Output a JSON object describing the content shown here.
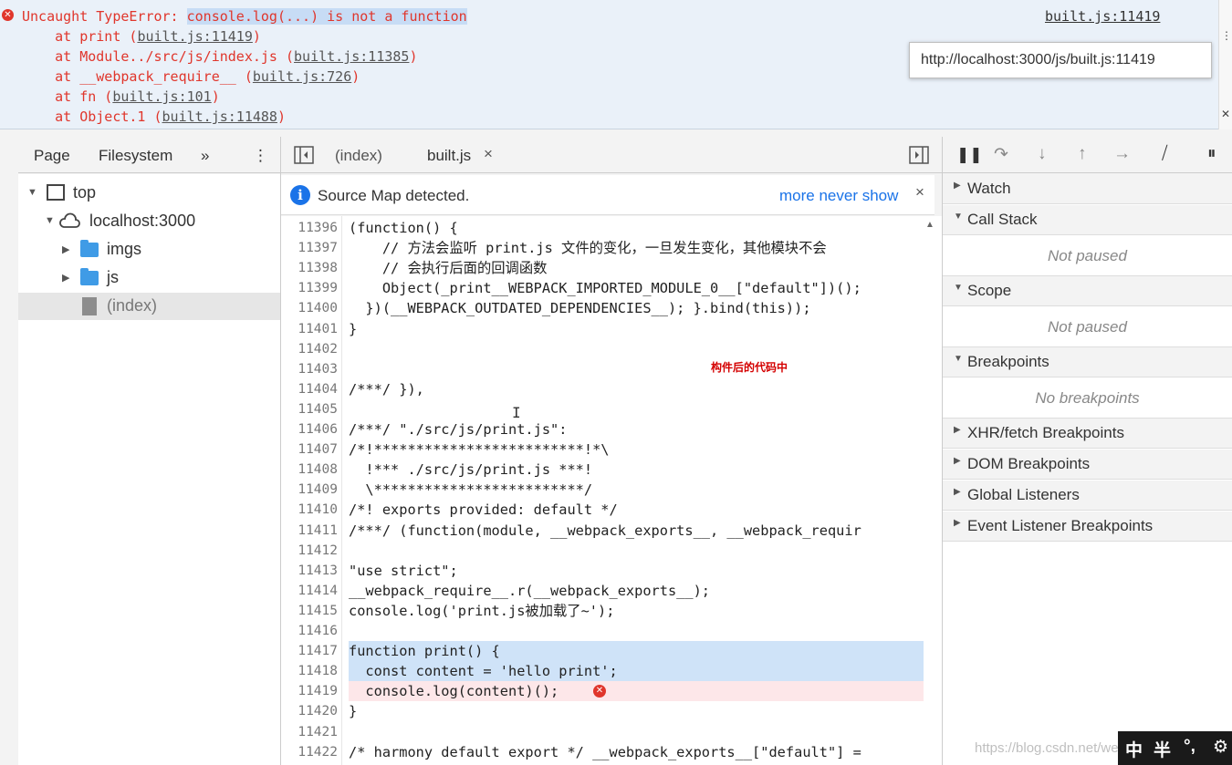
{
  "console": {
    "error_prefix": "Uncaught TypeError: ",
    "error_highlight": "console.log(...) is not a function",
    "error_location_link": "built.js:11419",
    "stack": [
      {
        "pre": "    at print (",
        "link": "built.js:11419",
        "post": ")"
      },
      {
        "pre": "    at Module../src/js/index.js (",
        "link": "built.js:11385",
        "post": ")"
      },
      {
        "pre": "    at __webpack_require__ (",
        "link": "built.js:726",
        "post": ")"
      },
      {
        "pre": "    at fn (",
        "link": "built.js:101",
        "post": ")"
      },
      {
        "pre": "    at Object.1 (",
        "link": "built.js:11488",
        "post": ")"
      }
    ],
    "tooltip": "http://localhost:3000/js/built.js:11419",
    "colors": {
      "error": "#e0362c",
      "highlight": "#c7dcf5"
    }
  },
  "navigator": {
    "tabs": [
      "Page",
      "Filesystem"
    ],
    "more_icon": "»",
    "menu_icon": "⋮",
    "tree": [
      {
        "label": "top",
        "icon": "frame-icon"
      },
      {
        "label": "localhost:3000",
        "icon": "cloud-icon"
      },
      {
        "label": "imgs",
        "icon": "folder-icon"
      },
      {
        "label": "js",
        "icon": "folder-icon"
      },
      {
        "label": "(index)",
        "icon": "file-icon"
      }
    ]
  },
  "editor": {
    "tabs": [
      {
        "label": "(index)"
      },
      {
        "label": "built.js",
        "close": "×"
      }
    ],
    "source_map": {
      "message": "Source Map detected.",
      "more": "more",
      "never_show": "never show",
      "close": "×"
    },
    "annotation": "构件后的代码中",
    "lines": [
      {
        "n": "11396",
        "t": "(function() {"
      },
      {
        "n": "11397",
        "t": "    // 方法会监听 print.js 文件的变化，一旦发生变化，其他模块不会"
      },
      {
        "n": "11398",
        "t": "    // 会执行后面的回调函数"
      },
      {
        "n": "11399",
        "t": "    Object(_print__WEBPACK_IMPORTED_MODULE_0__[\"default\"])();"
      },
      {
        "n": "11400",
        "t": "  })(__WEBPACK_OUTDATED_DEPENDENCIES__); }.bind(this));"
      },
      {
        "n": "11401",
        "t": "}"
      },
      {
        "n": "11402",
        "t": ""
      },
      {
        "n": "11403",
        "t": ""
      },
      {
        "n": "11404",
        "t": "/***/ }),"
      },
      {
        "n": "11405",
        "t": ""
      },
      {
        "n": "11406",
        "t": "/***/ \"./src/js/print.js\":"
      },
      {
        "n": "11407",
        "t": "/*!*************************!*\\"
      },
      {
        "n": "11408",
        "t": "  !*** ./src/js/print.js ***!"
      },
      {
        "n": "11409",
        "t": "  \\*************************/"
      },
      {
        "n": "11410",
        "t": "/*! exports provided: default */"
      },
      {
        "n": "11411",
        "t": "/***/ (function(module, __webpack_exports__, __webpack_requir"
      },
      {
        "n": "11412",
        "t": ""
      },
      {
        "n": "11413",
        "t": "\"use strict\";"
      },
      {
        "n": "11414",
        "t": "__webpack_require__.r(__webpack_exports__);"
      },
      {
        "n": "11415",
        "t": "console.log('print.js被加载了~');"
      },
      {
        "n": "11416",
        "t": ""
      },
      {
        "n": "11417",
        "t": "function print() {"
      },
      {
        "n": "11418",
        "t": "  const content = 'hello print';"
      },
      {
        "n": "11419",
        "t": "  console.log(content)();"
      },
      {
        "n": "11420",
        "t": "}"
      },
      {
        "n": "11421",
        "t": ""
      },
      {
        "n": "11422",
        "t": "/* harmony default export */ __webpack_exports__[\"default\"] ="
      }
    ],
    "highlighted_lines": [
      "11417",
      "11418"
    ],
    "error_line": "11419"
  },
  "debugger": {
    "sections": [
      {
        "label": "Watch",
        "open": false
      },
      {
        "label": "Call Stack",
        "open": true,
        "body": "Not paused"
      },
      {
        "label": "Scope",
        "open": true,
        "body": "Not paused"
      },
      {
        "label": "Breakpoints",
        "open": true,
        "body": "No breakpoints"
      },
      {
        "label": "XHR/fetch Breakpoints",
        "open": false
      },
      {
        "label": "DOM Breakpoints",
        "open": false
      },
      {
        "label": "Global Listeners",
        "open": false
      },
      {
        "label": "Event Listener Breakpoints",
        "open": false
      }
    ]
  },
  "overlay": {
    "watermark": "https://blog.csdn.net/we",
    "ime": [
      "中",
      "半",
      "°,",
      "⚙"
    ]
  }
}
